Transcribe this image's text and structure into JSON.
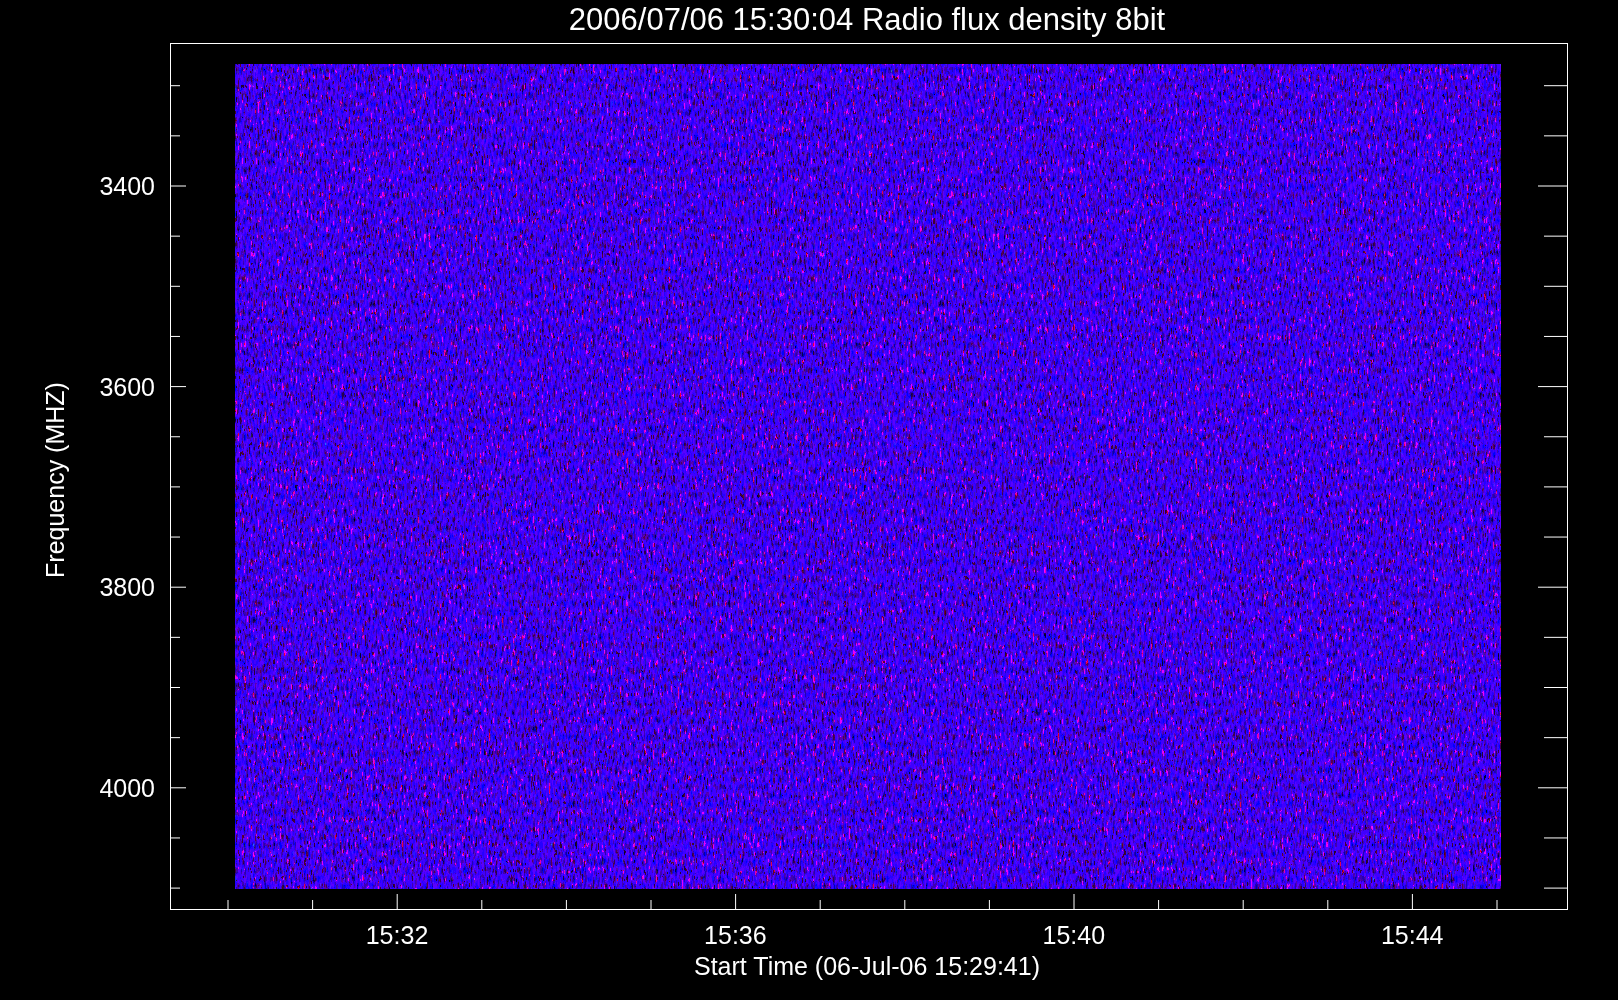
{
  "plot": {
    "title": "2006/07/06 15:30:04 Radio flux density 8bit",
    "y_axis": {
      "label": "Frequency (MHZ)",
      "ticks": [
        "3400",
        "3600",
        "3800",
        "4000"
      ]
    },
    "x_axis": {
      "label": "Start Time (06-Jul-06 15:29:41)",
      "ticks": [
        "15:32",
        "15:36",
        "15:40",
        "15:44"
      ]
    }
  }
}
